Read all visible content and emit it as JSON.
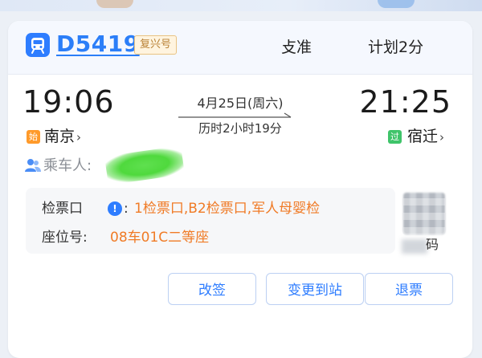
{
  "colors": {
    "accent": "#2e7dff",
    "orange": "#f07b26",
    "start_tag": "#ff9a2a",
    "end_tag": "#3fc46a",
    "redaction": "#4fd93d"
  },
  "header": {
    "train_icon": "train-icon",
    "train_number": "D5419",
    "train_type": "复兴号",
    "status_left": "攴准",
    "status_right": "计划2分"
  },
  "journey": {
    "departure_time": "19:06",
    "arrival_time": "21:25",
    "date": "4月25日(周六)",
    "duration": "历时2小时19分",
    "departure_tag": "始",
    "departure_station": "南京",
    "arrival_tag": "过",
    "arrival_station": "宿迁",
    "chevron": "›"
  },
  "passenger": {
    "icon": "passenger-icon",
    "label": "乘车人:"
  },
  "ticket_info": {
    "gate_label": "检票口",
    "gate_colon": ":",
    "gate_value": "1检票口,B2检票口,军人母婴检",
    "seat_label": "座位号:",
    "seat_value": "08车01C二等座",
    "qr_text": "码"
  },
  "actions": {
    "change": "改签",
    "change_station": "变更到站",
    "refund": "退票"
  }
}
